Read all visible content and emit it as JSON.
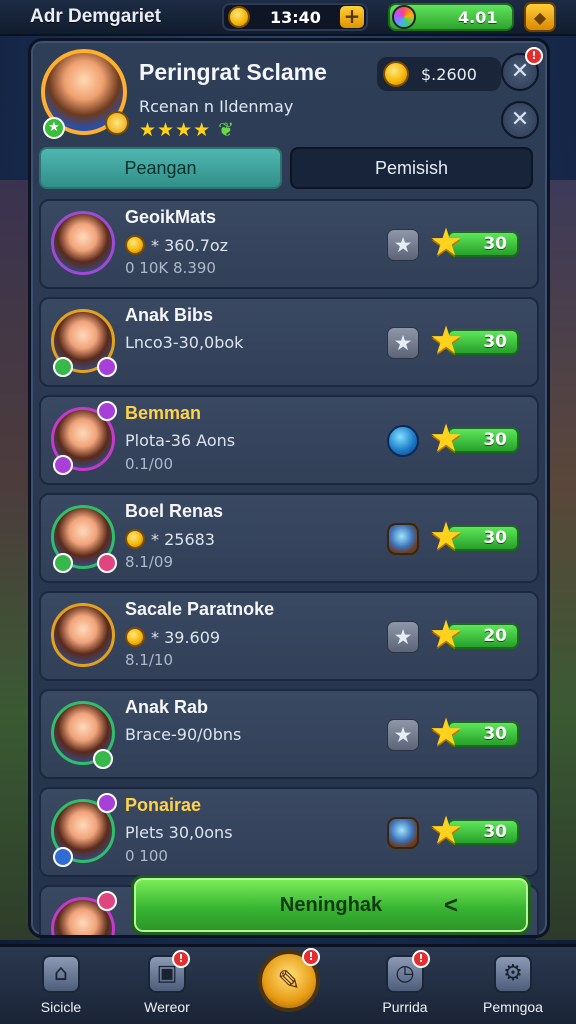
{
  "topbar": {
    "title": "Adr Demgariet",
    "coins": "13:40",
    "gems": "4.01"
  },
  "profile": {
    "name": "Peringrat Sclame",
    "subtitle": "Rcenan n Ildenmay",
    "stars": "★★★★",
    "coins": "$.2600",
    "notification": "!"
  },
  "tabs": [
    {
      "label": "Peangan",
      "active": true
    },
    {
      "label": "Pemisish",
      "active": false
    }
  ],
  "players": [
    {
      "name": "GeoikMats",
      "line2": "* 360.7oz",
      "line3": "0 10K 8.390",
      "has_coin": true,
      "reward_icon": "star-badge",
      "score": "30"
    },
    {
      "name": "Anak Bibs",
      "line2": "Lnco3-30,0bok",
      "line3": "",
      "has_coin": false,
      "reward_icon": "star-badge",
      "score": "30"
    },
    {
      "name": "Bemman",
      "line2": "Plota-36 Aons",
      "line3": "0.1/00",
      "has_coin": false,
      "reward_icon": "gem",
      "score": "30"
    },
    {
      "name": "Boel Renas",
      "line2": "* 25683",
      "line3": "8.1/09",
      "has_coin": true,
      "reward_icon": "orb",
      "score": "30"
    },
    {
      "name": "Sacale Paratnoke",
      "line2": "* 39.609",
      "line3": "8.1/10",
      "has_coin": true,
      "reward_icon": "star-badge",
      "score": "20"
    },
    {
      "name": "Anak Rab",
      "line2": "Brace-90/0bns",
      "line3": "",
      "has_coin": false,
      "reward_icon": "star-badge",
      "score": "30"
    },
    {
      "name": "Ponairae",
      "line2": "Plets 30,0ons",
      "line3": "0 100",
      "has_coin": false,
      "reward_icon": "orb",
      "score": "30"
    }
  ],
  "main_button": {
    "label": "Neninghak",
    "chevron": "<"
  },
  "nav": [
    {
      "label": "Sicicle",
      "icon": "home-icon"
    },
    {
      "label": "Wereor",
      "icon": "map-icon"
    },
    {
      "label": "",
      "icon": "battle-icon"
    },
    {
      "label": "Purrida",
      "icon": "clock-icon"
    },
    {
      "label": "Pemngoa",
      "icon": "gear-icon"
    }
  ],
  "colors": {
    "accent_green": "#39b533",
    "tab_active": "#4fb7b0",
    "gold": "#ffd21e"
  }
}
